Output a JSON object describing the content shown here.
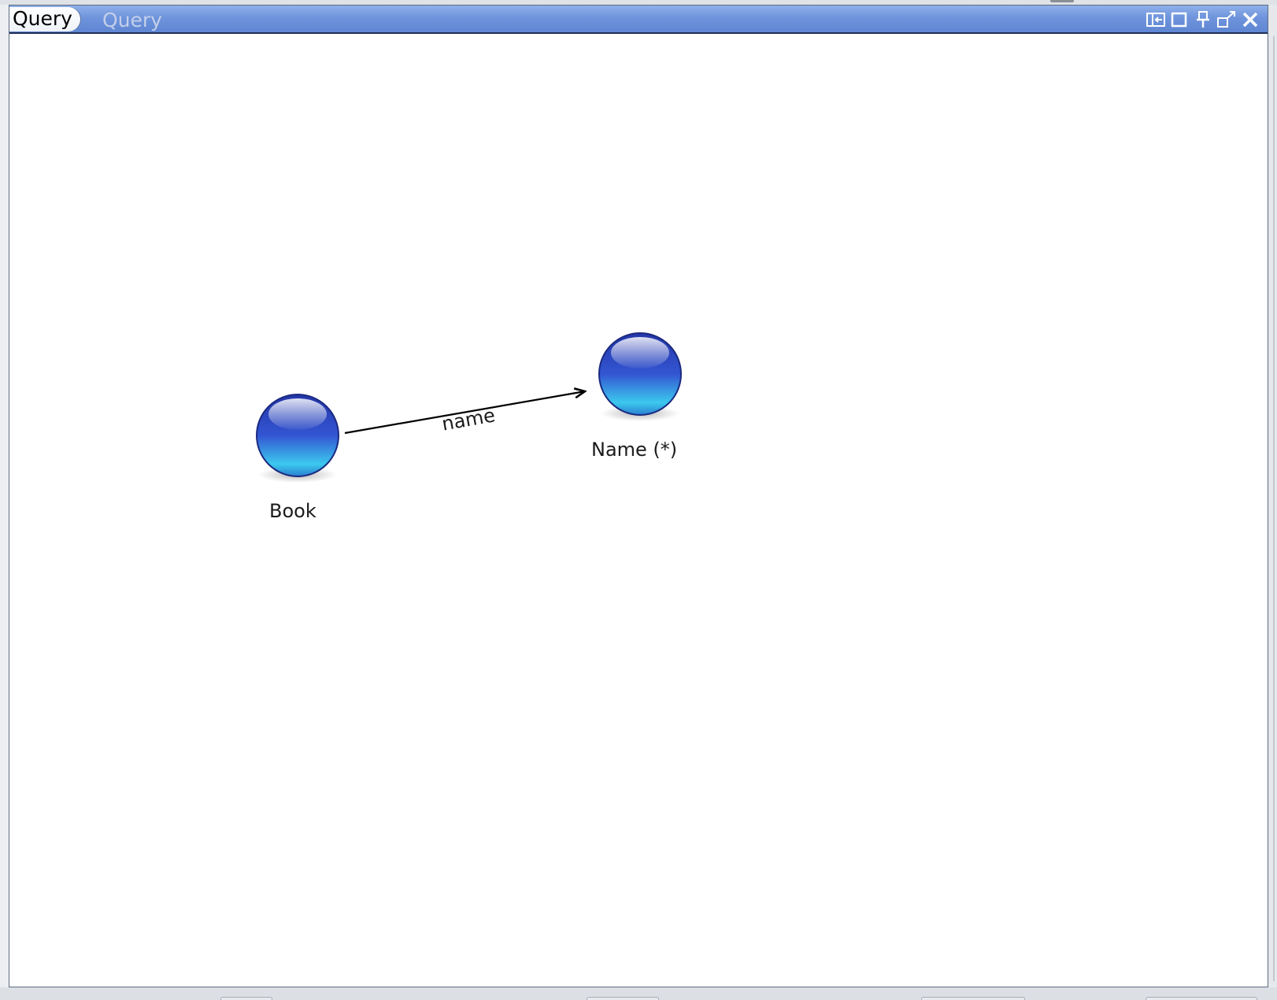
{
  "panel": {
    "tabs": [
      {
        "label": "Query",
        "active": true
      },
      {
        "label": "Query",
        "active": false
      }
    ],
    "window_buttons": [
      "minimize-to-side-icon",
      "maximize-icon",
      "pin-icon",
      "float-icon",
      "close-icon"
    ]
  },
  "graph": {
    "nodes": [
      {
        "id": "book",
        "label": "Book"
      },
      {
        "id": "name",
        "label": "Name (*)"
      }
    ],
    "edges": [
      {
        "from": "book",
        "to": "name",
        "label": "name"
      }
    ]
  },
  "colors": {
    "titlebar": "#6f94dc",
    "node_top": "#2f3fb8",
    "node_bottom": "#3fd3f0",
    "edge": "#000000"
  }
}
